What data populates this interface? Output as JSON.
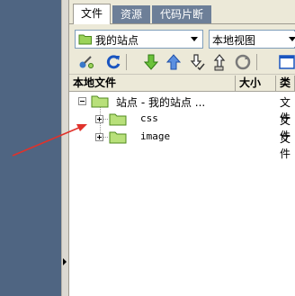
{
  "tabs": [
    {
      "label": "文件",
      "active": true
    },
    {
      "label": "资源",
      "active": false
    },
    {
      "label": "代码片断",
      "active": false
    }
  ],
  "site_select": {
    "value": "我的站点"
  },
  "view_select": {
    "value": "本地视图"
  },
  "toolbar_icons": [
    "connect-icon",
    "refresh-icon",
    "get-files-icon",
    "put-files-icon",
    "check-out-icon",
    "check-in-icon",
    "synchronize-icon",
    "expand-icon"
  ],
  "columns": {
    "local_files": "本地文件",
    "size": "大小",
    "type": "类"
  },
  "tree": {
    "root": {
      "label": "站点 - 我的站点 ...",
      "type": "文件"
    },
    "children": [
      {
        "label": "css",
        "type": "文件"
      },
      {
        "label": "image",
        "type": "文件"
      }
    ]
  },
  "colors": {
    "accent": "#e0322b",
    "panel": "#ece9d8",
    "tab_inactive": "#6d7f98",
    "backdrop": "#4f6582"
  }
}
